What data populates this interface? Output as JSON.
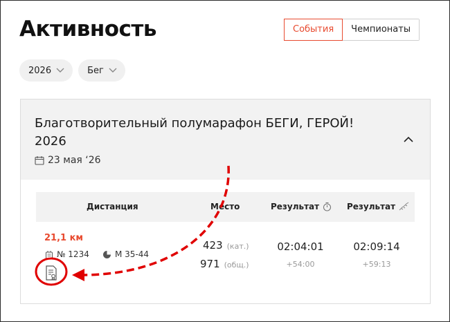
{
  "page": {
    "title": "Активность"
  },
  "tabs": [
    {
      "label": "События",
      "active": true
    },
    {
      "label": "Чемпионаты",
      "active": false
    }
  ],
  "filters": [
    {
      "label": "2026"
    },
    {
      "label": "Бег"
    }
  ],
  "event": {
    "title": "Благотворительный полумарафон БЕГИ, ГЕРОЙ! 2026",
    "date": "23 мая ‘26"
  },
  "table": {
    "headers": {
      "distance": "Дистанция",
      "place": "Место",
      "result_gun": "Результат",
      "result_chip": "Результат"
    },
    "row": {
      "distance": "21,1 км",
      "bib": "№ 1234",
      "category": "М 35-44",
      "place_category": "423",
      "place_category_label": "(кат.)",
      "place_overall": "971",
      "place_overall_label": "(общ.)",
      "result_gun": "02:04:01",
      "result_gun_gap": "+54:00",
      "result_chip": "02:09:14",
      "result_chip_gap": "+59:13"
    }
  },
  "colors": {
    "accent": "#e84a2f",
    "annotation": "#e00000"
  }
}
